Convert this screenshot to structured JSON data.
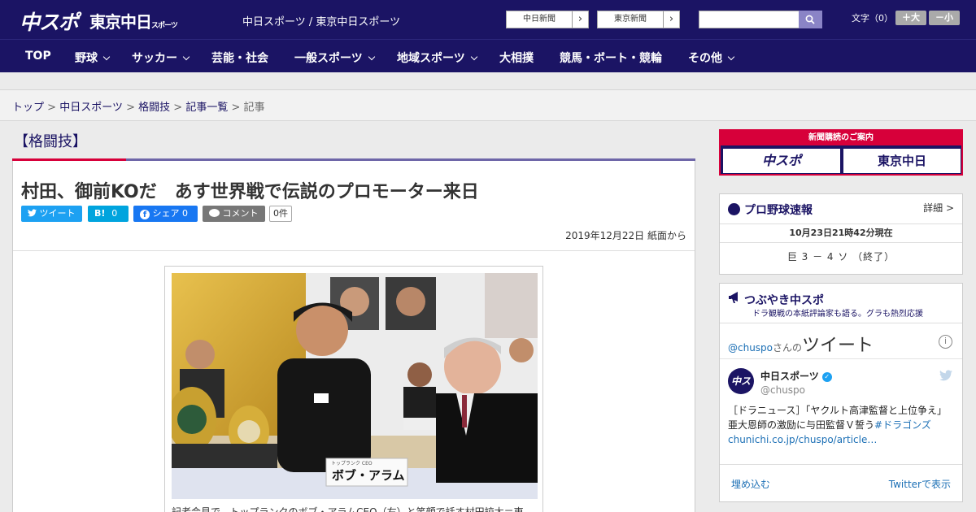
{
  "header": {
    "logo": "中スポ",
    "logo_tokyo": "東京中日",
    "logo_tokyo_sub": "スポーツ",
    "site_title": "中日スポーツ / 東京中日スポーツ",
    "link1": "中日新聞",
    "link2": "東京新聞",
    "search_placeholder": "",
    "font_size_label": "文字（0）",
    "font_plus": "＋大",
    "font_minus": "－小"
  },
  "nav": [
    {
      "label": "TOP",
      "has_menu": false
    },
    {
      "label": "野球",
      "has_menu": true
    },
    {
      "label": "サッカー",
      "has_menu": true
    },
    {
      "label": "芸能・社会",
      "has_menu": false
    },
    {
      "label": "一般スポーツ",
      "has_menu": true
    },
    {
      "label": "地域スポーツ",
      "has_menu": true
    },
    {
      "label": "大相撲",
      "has_menu": false
    },
    {
      "label": "競馬・ボート・競輪",
      "has_menu": false
    },
    {
      "label": "その他",
      "has_menu": true
    }
  ],
  "breadcrumb": {
    "items": [
      "トップ",
      "中日スポーツ",
      "格闘技",
      "記事一覧"
    ],
    "current": "記事",
    "separator": ">"
  },
  "article": {
    "category": "【格闘技】",
    "headline": "村田、御前KOだ　あす世界戦で伝説のプロモーター来日",
    "share": {
      "tweet": "ツイート",
      "hatena": "B!",
      "hatena_count": "0",
      "facebook": "シェア",
      "facebook_count": "0",
      "comment": "コメント",
      "comment_count": "0件"
    },
    "date": "2019年12月22日 紙面から",
    "photo_sign": "ボブ・アラム",
    "photo_sign_small": "トップランク CEO",
    "caption": "記者会見で、トップランクのボブ・アラムCEO（右）と笑顔で話す村田諒太＝東"
  },
  "sidebar": {
    "ad": {
      "top": "新聞購読のご案内",
      "logo1": "中スポ",
      "logo2": "東京中日"
    },
    "baseball": {
      "title": "プロ野球速報",
      "more": "詳細 >",
      "time": "10月23日21時42分現在",
      "score": "巨 3 － 4 ソ （終了）"
    },
    "twitter": {
      "title": "つぶやき中スポ",
      "subtitle": "ドラ観戦の本紙評論家も語る。グラも熱烈応援",
      "head_handle": "@chuspo",
      "head_suffix": "さんの",
      "head_big": "ツイート",
      "account_name": "中日スポーツ",
      "account_handle": "@chuspo",
      "tweet_text": "［ドラニュース］「ヤクルト高津監督と上位争え」亜大恩師の激励に与田監督Ｖ誓う",
      "tweet_hashtag": "#ドラゴンズ",
      "tweet_link": "chunichi.co.jp/chuspo/article…",
      "embed": "埋め込む",
      "view": "Twitterで表示"
    }
  },
  "colors": {
    "brand_navy": "#1b1464",
    "accent_red": "#d7003a",
    "twitter_blue": "#1da1f2",
    "facebook_blue": "#1877f2"
  }
}
